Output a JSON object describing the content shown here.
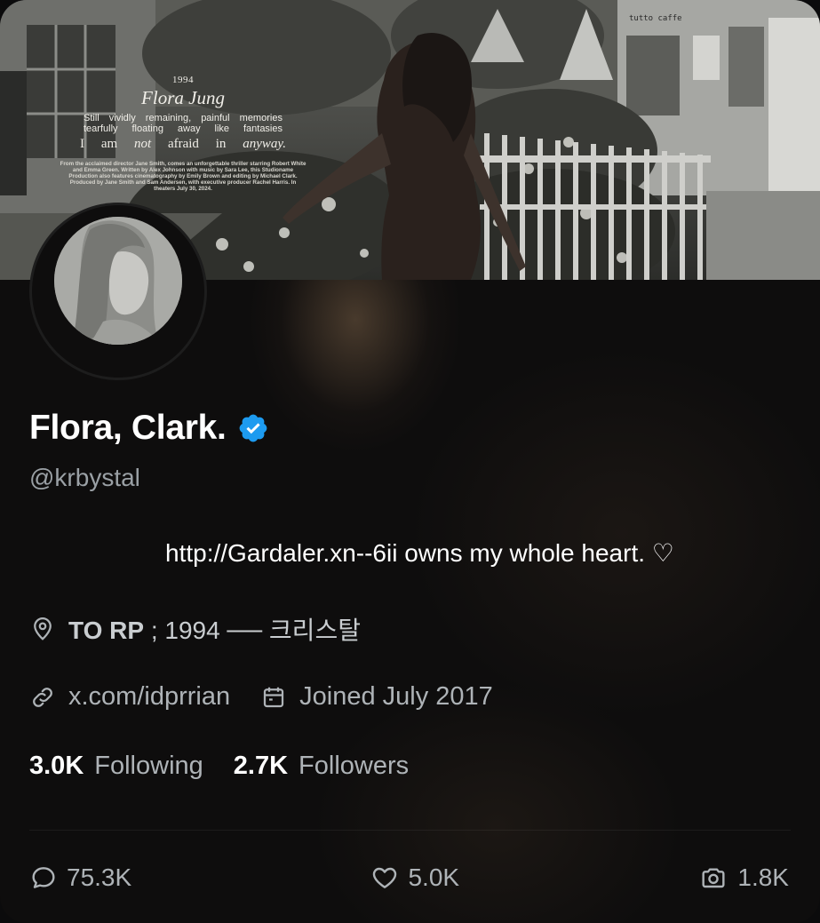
{
  "banner": {
    "poster": {
      "year": "1994",
      "title": "Flora Jung",
      "line1": [
        "Still",
        "vividly",
        "remaining,",
        "painful",
        "memories"
      ],
      "line2": [
        "tearfully",
        "floating",
        "away",
        "like",
        "fantasies"
      ],
      "line3": [
        "I",
        "am",
        "not",
        "afraid",
        "in",
        "anyway."
      ],
      "credits": "From the acclaimed director Jane Smith, comes an unforgettable thriller starring Robert White and Emma Green. Written by Alex Johnson with music by Sara Lee, this Studioname Production also features cinematography by Emily Brown and editing by Michael Clark. Produced by Jane Smith and Sam Andersen, with executive producer Rachel Harris. In theaters July 30, 2024."
    },
    "cafe_sign": "tutto caffe"
  },
  "profile": {
    "display_name": "Flora, Clark.",
    "verified_icon": "verified-badge-icon",
    "handle": "@krbystal",
    "bio": "http://Gardaler.xn--6ii owns my whole heart. ♡",
    "location": {
      "icon": "location-pin-icon",
      "strong": "TO RP",
      "rest": " ; 1994 ── 크리스탈"
    },
    "website": {
      "icon": "link-icon",
      "text": "x.com/idprrian"
    },
    "joined": {
      "icon": "calendar-icon",
      "text": "Joined July 2017"
    },
    "following": {
      "count": "3.0K",
      "label": "Following"
    },
    "followers": {
      "count": "2.7K",
      "label": "Followers"
    }
  },
  "stats": {
    "replies": {
      "icon": "reply-icon",
      "value": "75.3K"
    },
    "likes": {
      "icon": "heart-icon",
      "value": "5.0K"
    },
    "media": {
      "icon": "camera-icon",
      "value": "1.8K"
    }
  },
  "colors": {
    "verified": "#1d9bf0",
    "background": "#0e0d0d",
    "text_primary": "#ffffff",
    "text_secondary": "#aeb3b7"
  }
}
